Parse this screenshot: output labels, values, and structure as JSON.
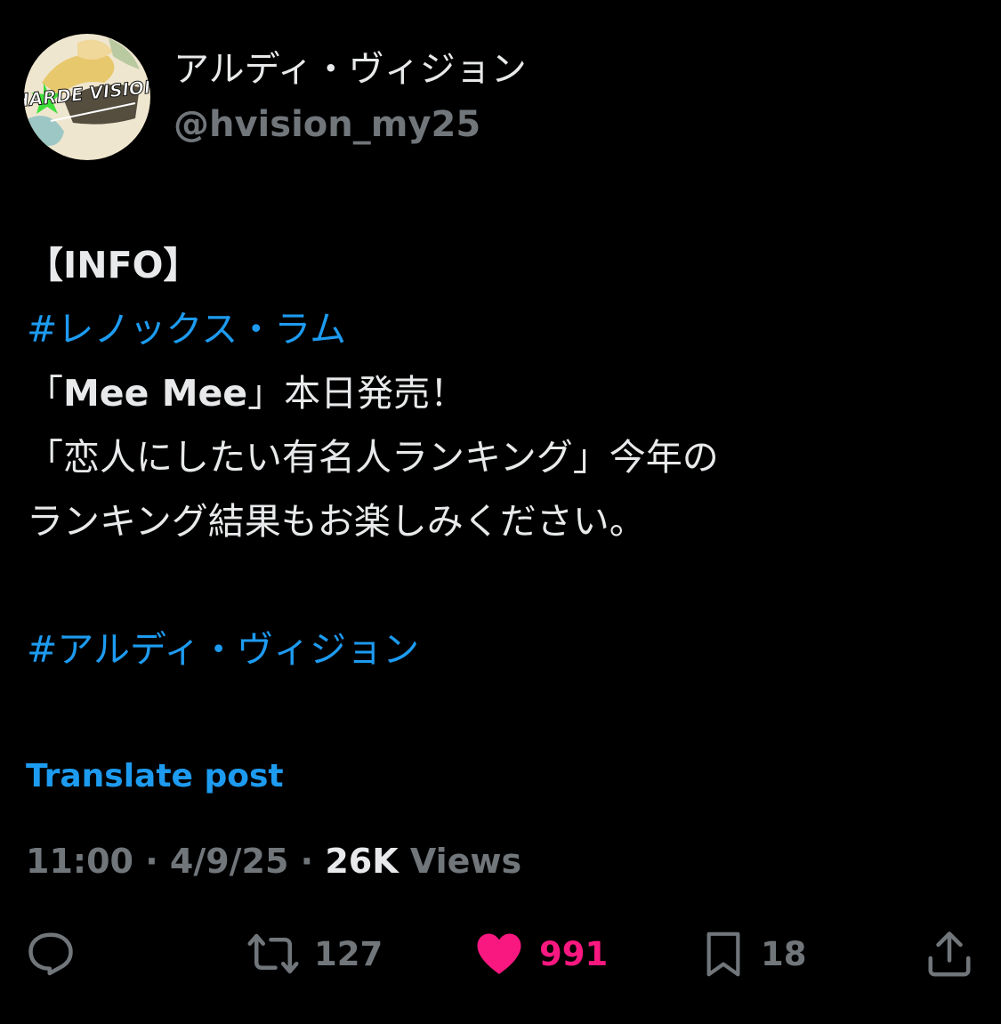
{
  "author": {
    "display_name": "アルディ・ヴィジョン",
    "handle": "@hvision_my25",
    "avatar_text": "HARDE VISION",
    "avatar_icon": "avatar-logo"
  },
  "post": {
    "line1": "【INFO】",
    "hashtag1": "#レノックス・ラム",
    "line3_a": "「",
    "line3_b": "Mee Mee",
    "line3_c": "」本日発売！",
    "line4": "「恋人にしたい有名人ランキング」今年の",
    "line5": "ランキング結果もお楽しみください。",
    "hashtag2": "#アルディ・ヴィジョン"
  },
  "translate_label": "Translate post",
  "meta": {
    "time": "11:00",
    "separator": " · ",
    "date": "4/9/25",
    "views_count": "26K",
    "views_label": " Views"
  },
  "actions": {
    "reply": {
      "icon": "reply-icon",
      "count": ""
    },
    "repost": {
      "icon": "repost-icon",
      "count": "127"
    },
    "like": {
      "icon": "heart-icon",
      "count": "991",
      "active": true
    },
    "bookmark": {
      "icon": "bookmark-icon",
      "count": "18"
    },
    "share": {
      "icon": "share-icon",
      "count": ""
    }
  },
  "colors": {
    "background": "#000000",
    "text": "#e7e9ea",
    "secondary": "#71767b",
    "accent": "#1d9bf0",
    "like": "#f91880"
  }
}
